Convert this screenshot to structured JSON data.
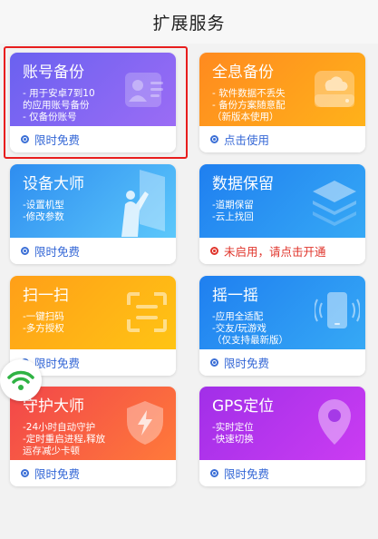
{
  "header": {
    "title": "扩展服务"
  },
  "cards": [
    {
      "title": "账号备份",
      "desc": [
        "- 用于安卓7到10",
        "的应用账号备份",
        "- 仅备份账号"
      ],
      "status": "限时免费",
      "icon": "account-card-icon"
    },
    {
      "title": "全息备份",
      "desc": [
        "- 软件数据不丢失",
        "- 备份方案随意配",
        "（新版本使用）"
      ],
      "status": "点击使用",
      "icon": "cloud-drive-icon"
    },
    {
      "title": "设备大师",
      "desc": [
        "-设置机型",
        "-修改参数"
      ],
      "status": "限时免费",
      "icon": "person-screen-icon"
    },
    {
      "title": "数据保留",
      "desc": [
        "-道期保留",
        "-云上找回"
      ],
      "status": "未启用，请点击开通",
      "icon": "layers-icon"
    },
    {
      "title": "扫一扫",
      "desc": [
        "-一键扫码",
        "-多方授权"
      ],
      "status": "限时免费",
      "icon": "scan-icon"
    },
    {
      "title": "摇一摇",
      "desc": [
        "-应用全适配",
        "-交友/玩游戏",
        "（仅支持最新版）"
      ],
      "status": "限时免费",
      "icon": "shake-phone-icon"
    },
    {
      "title": "守护大师",
      "desc": [
        "-24小时自动守护",
        "-定时重启进程,释放",
        "运存减少卡顿"
      ],
      "status": "限时免费",
      "icon": "shield-bolt-icon"
    },
    {
      "title": "GPS定位",
      "desc": [
        "-实时定位",
        "-快速切换"
      ],
      "status": "限时免费",
      "icon": "location-pin-icon"
    }
  ],
  "colors": {
    "accent": "#3467d6",
    "warning": "#e0342b",
    "highlight": "#e81e1e"
  },
  "floating": {
    "icon": "wifi-icon"
  }
}
